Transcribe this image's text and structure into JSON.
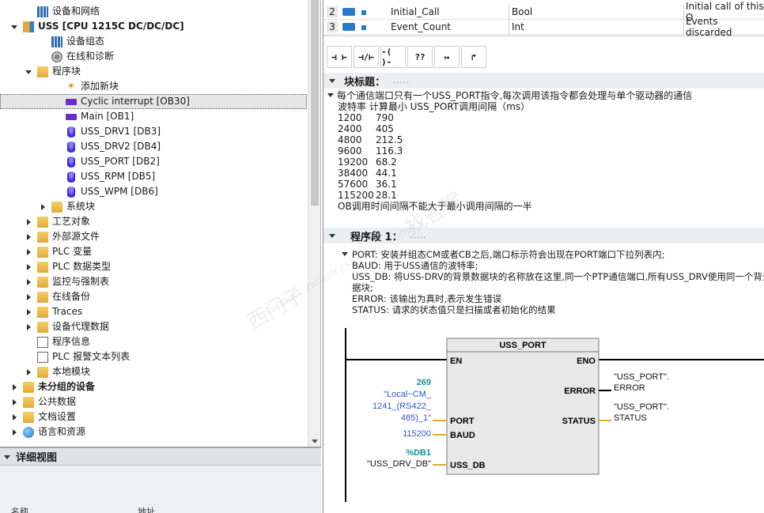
{
  "tree": {
    "items": [
      {
        "label": "设备和网络",
        "indent": 1,
        "toggle": "none",
        "icon": "network-icon",
        "bold": false
      },
      {
        "label": "USS [CPU 1215C DC/DC/DC]",
        "indent": 0,
        "toggle": "expanded",
        "icon": "plc-icon",
        "bold": true
      },
      {
        "label": "设备组态",
        "indent": 2,
        "toggle": "none",
        "icon": "device-config-icon",
        "bold": false
      },
      {
        "label": "在线和诊断",
        "indent": 2,
        "toggle": "none",
        "icon": "online-diagnostics-icon",
        "bold": false
      },
      {
        "label": "程序块",
        "indent": 1,
        "toggle": "expanded",
        "icon": "folder-icon",
        "bold": false
      },
      {
        "label": "添加新块",
        "indent": 3,
        "toggle": "none",
        "icon": "add-block-icon",
        "bold": false
      },
      {
        "label": "Cyclic interrupt [OB30]",
        "indent": 3,
        "toggle": "none",
        "icon": "ob-icon",
        "bold": false,
        "selected": true
      },
      {
        "label": "Main [OB1]",
        "indent": 3,
        "toggle": "none",
        "icon": "ob-icon",
        "bold": false
      },
      {
        "label": "USS_DRV1 [DB3]",
        "indent": 3,
        "toggle": "none",
        "icon": "db-icon",
        "bold": false
      },
      {
        "label": "USS_DRV2 [DB4]",
        "indent": 3,
        "toggle": "none",
        "icon": "db-icon",
        "bold": false
      },
      {
        "label": "USS_PORT [DB2]",
        "indent": 3,
        "toggle": "none",
        "icon": "db-icon",
        "bold": false
      },
      {
        "label": "USS_RPM [DB5]",
        "indent": 3,
        "toggle": "none",
        "icon": "db-icon",
        "bold": false
      },
      {
        "label": "USS_WPM [DB6]",
        "indent": 3,
        "toggle": "none",
        "icon": "db-icon",
        "bold": false
      },
      {
        "label": "系统块",
        "indent": 2,
        "toggle": "collapsed",
        "icon": "folder-icon",
        "bold": false
      },
      {
        "label": "工艺对象",
        "indent": 1,
        "toggle": "collapsed",
        "icon": "folder-icon",
        "bold": false
      },
      {
        "label": "外部源文件",
        "indent": 1,
        "toggle": "collapsed",
        "icon": "folder-icon",
        "bold": false
      },
      {
        "label": "PLC 变量",
        "indent": 1,
        "toggle": "collapsed",
        "icon": "folder-icon",
        "bold": false
      },
      {
        "label": "PLC 数据类型",
        "indent": 1,
        "toggle": "collapsed",
        "icon": "folder-icon",
        "bold": false
      },
      {
        "label": "监控与强制表",
        "indent": 1,
        "toggle": "collapsed",
        "icon": "folder-icon",
        "bold": false
      },
      {
        "label": "在线备份",
        "indent": 1,
        "toggle": "collapsed",
        "icon": "folder-icon",
        "bold": false
      },
      {
        "label": "Traces",
        "indent": 1,
        "toggle": "collapsed",
        "icon": "folder-icon",
        "bold": false
      },
      {
        "label": "设备代理数据",
        "indent": 1,
        "toggle": "collapsed",
        "icon": "folder-icon",
        "bold": false
      },
      {
        "label": "程序信息",
        "indent": 1,
        "toggle": "none",
        "icon": "program-info-icon",
        "bold": false
      },
      {
        "label": "PLC 报警文本列表",
        "indent": 1,
        "toggle": "none",
        "icon": "alarm-text-icon",
        "bold": false
      },
      {
        "label": "本地模块",
        "indent": 1,
        "toggle": "collapsed",
        "icon": "folder-icon",
        "bold": false
      },
      {
        "label": "未分组的设备",
        "indent": 0,
        "toggle": "collapsed",
        "icon": "folder-icon",
        "bold": true
      },
      {
        "label": "公共数据",
        "indent": 0,
        "toggle": "collapsed",
        "icon": "folder-icon",
        "bold": false
      },
      {
        "label": "文档设置",
        "indent": 0,
        "toggle": "collapsed",
        "icon": "folder-icon",
        "bold": false
      },
      {
        "label": "语言和资源",
        "indent": 0,
        "toggle": "collapsed",
        "icon": "globe-icon",
        "bold": false
      }
    ]
  },
  "details": {
    "title": "详细视图",
    "col_name": "名称",
    "col_address": "地址"
  },
  "interface": {
    "rows": [
      {
        "num": "2",
        "name": "Initial_Call",
        "type": "Bool",
        "comment": "Initial call of this O"
      },
      {
        "num": "3",
        "name": "Event_Count",
        "type": "Int",
        "comment": "Events discarded"
      }
    ]
  },
  "toolbar": {
    "buttons": [
      {
        "name": "normally-open-contact-button",
        "glyph": "⊣ ⊢"
      },
      {
        "name": "normally-closed-contact-button",
        "glyph": "⊣/⊢"
      },
      {
        "name": "coil-button",
        "glyph": "-( )-"
      },
      {
        "name": "empty-box-button",
        "glyph": "??"
      },
      {
        "name": "open-branch-button",
        "glyph": "↦"
      },
      {
        "name": "close-branch-button",
        "glyph": "↱"
      }
    ]
  },
  "block": {
    "title_label": "块标题：",
    "title_dots": ".....",
    "comment_lines": [
      "每个通信端口只有一个USS_PORT指令,每次调用该指令都会处理与单个驱动器的通信",
      "波特率  计算最小 USS_PORT调用间隔（ms）"
    ],
    "baud_table": [
      {
        "baud": "1200",
        "ms": "790"
      },
      {
        "baud": "2400",
        "ms": "405"
      },
      {
        "baud": "4800",
        "ms": "212.5"
      },
      {
        "baud": "9600",
        "ms": "116.3"
      },
      {
        "baud": "19200",
        "ms": "68.2"
      },
      {
        "baud": "38400",
        "ms": "44.1"
      },
      {
        "baud": "57600",
        "ms": "36.1"
      },
      {
        "baud": "115200",
        "ms": "28.1"
      }
    ],
    "footer_line": "OB调用时间间隔不能大于最小调用间隔的一半"
  },
  "network": {
    "title_label": "程序段 1：",
    "title_dots": ".....",
    "comment_lines": [
      "PORT: 安装并组态CM或者CB之后,端口标示符会出现在PORT端口下拉列表内;",
      "BAUD: 用于USS通信的波特率;",
      "USS_DB: 将USS-DRV的背景数据块的名称放在这里,同一个PTP通信端口,所有USS_DRV使用同一个背景数",
      "据块;",
      "ERROR: 该输出为真时,表示发生错误",
      "STATUS: 请求的状态值只是扫描或者初始化的结果"
    ]
  },
  "ladder": {
    "box_title": "USS_PORT",
    "pin_en": "EN",
    "pin_eno": "ENO",
    "pin_port": "PORT",
    "pin_baud": "BAUD",
    "pin_uss_db": "USS_DB",
    "pin_error": "ERROR",
    "pin_status": "STATUS",
    "port_const": "269",
    "port_param_1": "\"Local~CM_",
    "port_param_2": "1241_(RS422_",
    "port_param_3": "485)_1\"",
    "baud_value": "115200",
    "db_ref": "%DB1",
    "db_name": "\"USS_DRV_DB\"",
    "error_out_1": "\"USS_PORT\".",
    "error_out_2": "ERROR",
    "status_out_1": "\"USS_PORT\".",
    "status_out_2": "STATUS"
  },
  "colors": {
    "accent_blue": "#2a7ac9",
    "param_teal": "#1a8fa0",
    "link_blue": "#3355cc",
    "box_fill": "#e8e8e8"
  },
  "watermark": {
    "line1": "西门子",
    "line2": "support.industry.siemens.com/cs",
    "line3": "找答案"
  }
}
